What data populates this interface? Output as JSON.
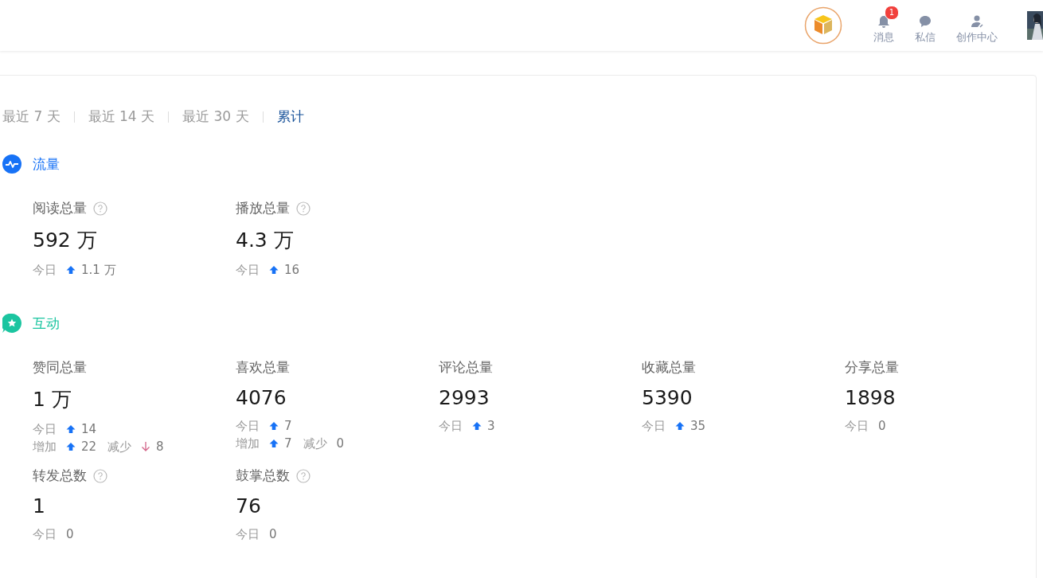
{
  "header": {
    "nav": [
      {
        "label": "消息",
        "kind": "bell",
        "badge": "1"
      },
      {
        "label": "私信",
        "kind": "chat"
      },
      {
        "label": "创作中心",
        "kind": "creator"
      }
    ]
  },
  "periods": [
    {
      "label": "最近 7 天",
      "selected": false
    },
    {
      "label": "最近 14 天",
      "selected": false
    },
    {
      "label": "最近 30 天",
      "selected": false
    },
    {
      "label": "累计",
      "selected": true
    }
  ],
  "sections": [
    {
      "title": "流量",
      "kind": "traffic",
      "color": "#1772f6",
      "metrics": [
        {
          "label": "阅读总量",
          "help": true,
          "value": "592 万",
          "stats": [
            [
              {
                "label": "今日",
                "kind": "up",
                "value": "1.1 万"
              }
            ]
          ]
        },
        {
          "label": "播放总量",
          "help": true,
          "value": "4.3 万",
          "stats": [
            [
              {
                "label": "今日",
                "kind": "up",
                "value": "16"
              }
            ]
          ]
        }
      ]
    },
    {
      "title": "互动",
      "kind": "interaction",
      "color": "#1bc5a0",
      "metrics": [
        {
          "label": "赞同总量",
          "help": false,
          "value": "1 万",
          "stats": [
            [
              {
                "label": "今日",
                "kind": "up",
                "value": "14"
              }
            ],
            [
              {
                "label": "增加",
                "kind": "up",
                "value": "22"
              },
              {
                "label": "减少",
                "kind": "down",
                "value": "8"
              }
            ]
          ]
        },
        {
          "label": "喜欢总量",
          "help": false,
          "value": "4076",
          "stats": [
            [
              {
                "label": "今日",
                "kind": "up",
                "value": "7"
              }
            ],
            [
              {
                "label": "增加",
                "kind": "up",
                "value": "7"
              },
              {
                "label": "减少",
                "kind": "plain",
                "value": "0"
              }
            ]
          ]
        },
        {
          "label": "评论总量",
          "help": false,
          "value": "2993",
          "stats": [
            [
              {
                "label": "今日",
                "kind": "up",
                "value": "3"
              }
            ]
          ]
        },
        {
          "label": "收藏总量",
          "help": false,
          "value": "5390",
          "stats": [
            [
              {
                "label": "今日",
                "kind": "up",
                "value": "35"
              }
            ]
          ]
        },
        {
          "label": "分享总量",
          "help": false,
          "value": "1898",
          "stats": [
            [
              {
                "label": "今日",
                "kind": "plain",
                "value": "0"
              }
            ]
          ]
        },
        {
          "label": "转发总数",
          "help": true,
          "value": "1",
          "stats": [
            [
              {
                "label": "今日",
                "kind": "plain",
                "value": "0"
              }
            ]
          ]
        },
        {
          "label": "鼓掌总数",
          "help": true,
          "value": "76",
          "stats": [
            [
              {
                "label": "今日",
                "kind": "plain",
                "value": "0"
              }
            ]
          ]
        }
      ]
    }
  ]
}
